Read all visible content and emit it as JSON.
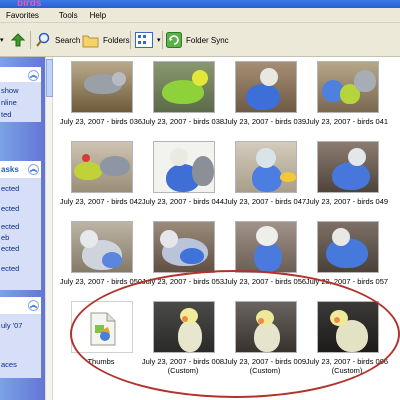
{
  "window": {
    "title": "birds"
  },
  "menu": [
    "Favorites",
    "Tools",
    "Help"
  ],
  "toolbar": {
    "search_label": "Search",
    "folders_label": "Folders",
    "folder_sync_label": "Folder Sync"
  },
  "left_pane": {
    "section1": {
      "lines": [
        "show",
        "nline",
        "ted"
      ]
    },
    "section2": {
      "title": "asks",
      "lines": [
        "ected",
        "ected",
        "ected",
        "eb",
        "ected",
        "ected"
      ]
    },
    "section3": {
      "lines": [
        "uly '07",
        "aces"
      ]
    }
  },
  "files": [
    {
      "name": "July 23, 2007 - birds 036"
    },
    {
      "name": "July 23, 2007 - birds 038"
    },
    {
      "name": "July 23, 2007 - birds 039"
    },
    {
      "name": "July 23, 2007 - birds 041"
    },
    {
      "name": "July 23, 2007 - birds 042"
    },
    {
      "name": "July 23, 2007 - birds 044"
    },
    {
      "name": "July 23, 2007 - birds 047"
    },
    {
      "name": "July 23, 2007 - birds 049"
    },
    {
      "name": "July 23, 2007 - birds 050"
    },
    {
      "name": "July 23, 2007 - birds 053"
    },
    {
      "name": "July 23, 2007 - birds 056"
    },
    {
      "name": "July 23, 2007 - birds 057"
    },
    {
      "name": "Thumbs"
    },
    {
      "name": "July 23, 2007 - birds 008",
      "sub": "(Custom)"
    },
    {
      "name": "July 23, 2007 - birds 009",
      "sub": "(Custom)"
    },
    {
      "name": "July 23, 2007 - birds 006",
      "sub": "(Custom)"
    }
  ]
}
